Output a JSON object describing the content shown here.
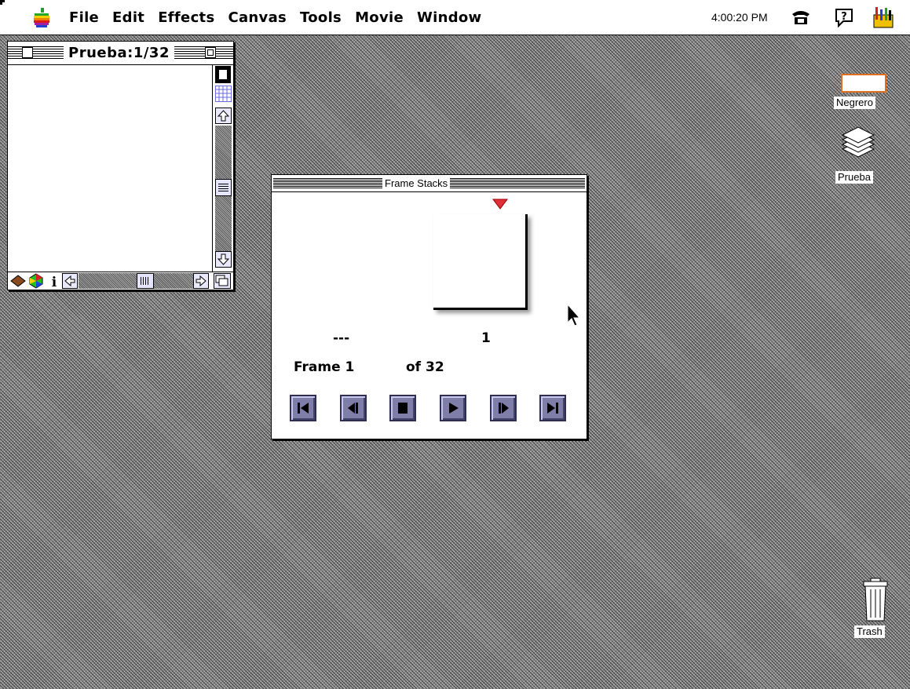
{
  "menubar": {
    "items": [
      "File",
      "Edit",
      "Effects",
      "Canvas",
      "Tools",
      "Movie",
      "Window"
    ],
    "clock": "4:00:20 PM",
    "icons": [
      "apple-icon",
      "phone-icon",
      "help-icon",
      "app-icon"
    ]
  },
  "prueba_window": {
    "title": "Prueba:1/32",
    "tool_icons": [
      "brush-icon",
      "color-wheel-icon",
      "info-icon",
      "arrow-left-icon",
      "arrow-right-icon",
      "frame-icon"
    ]
  },
  "frame_stacks": {
    "title": "Frame Stacks",
    "left_marker": "---",
    "right_marker": "1",
    "frame_label": "Frame 1",
    "of_label": "of 32",
    "controls": [
      "first-frame",
      "step-back",
      "stop",
      "play",
      "step-forward",
      "last-frame"
    ]
  },
  "desktop": {
    "icons": [
      {
        "label": "Negrero"
      },
      {
        "label": "Prueba"
      },
      {
        "label": "Trash"
      }
    ]
  },
  "colors": {
    "desktop": "#8c8c8c",
    "button": "#7e7ea8",
    "marker": "#e0303a"
  }
}
